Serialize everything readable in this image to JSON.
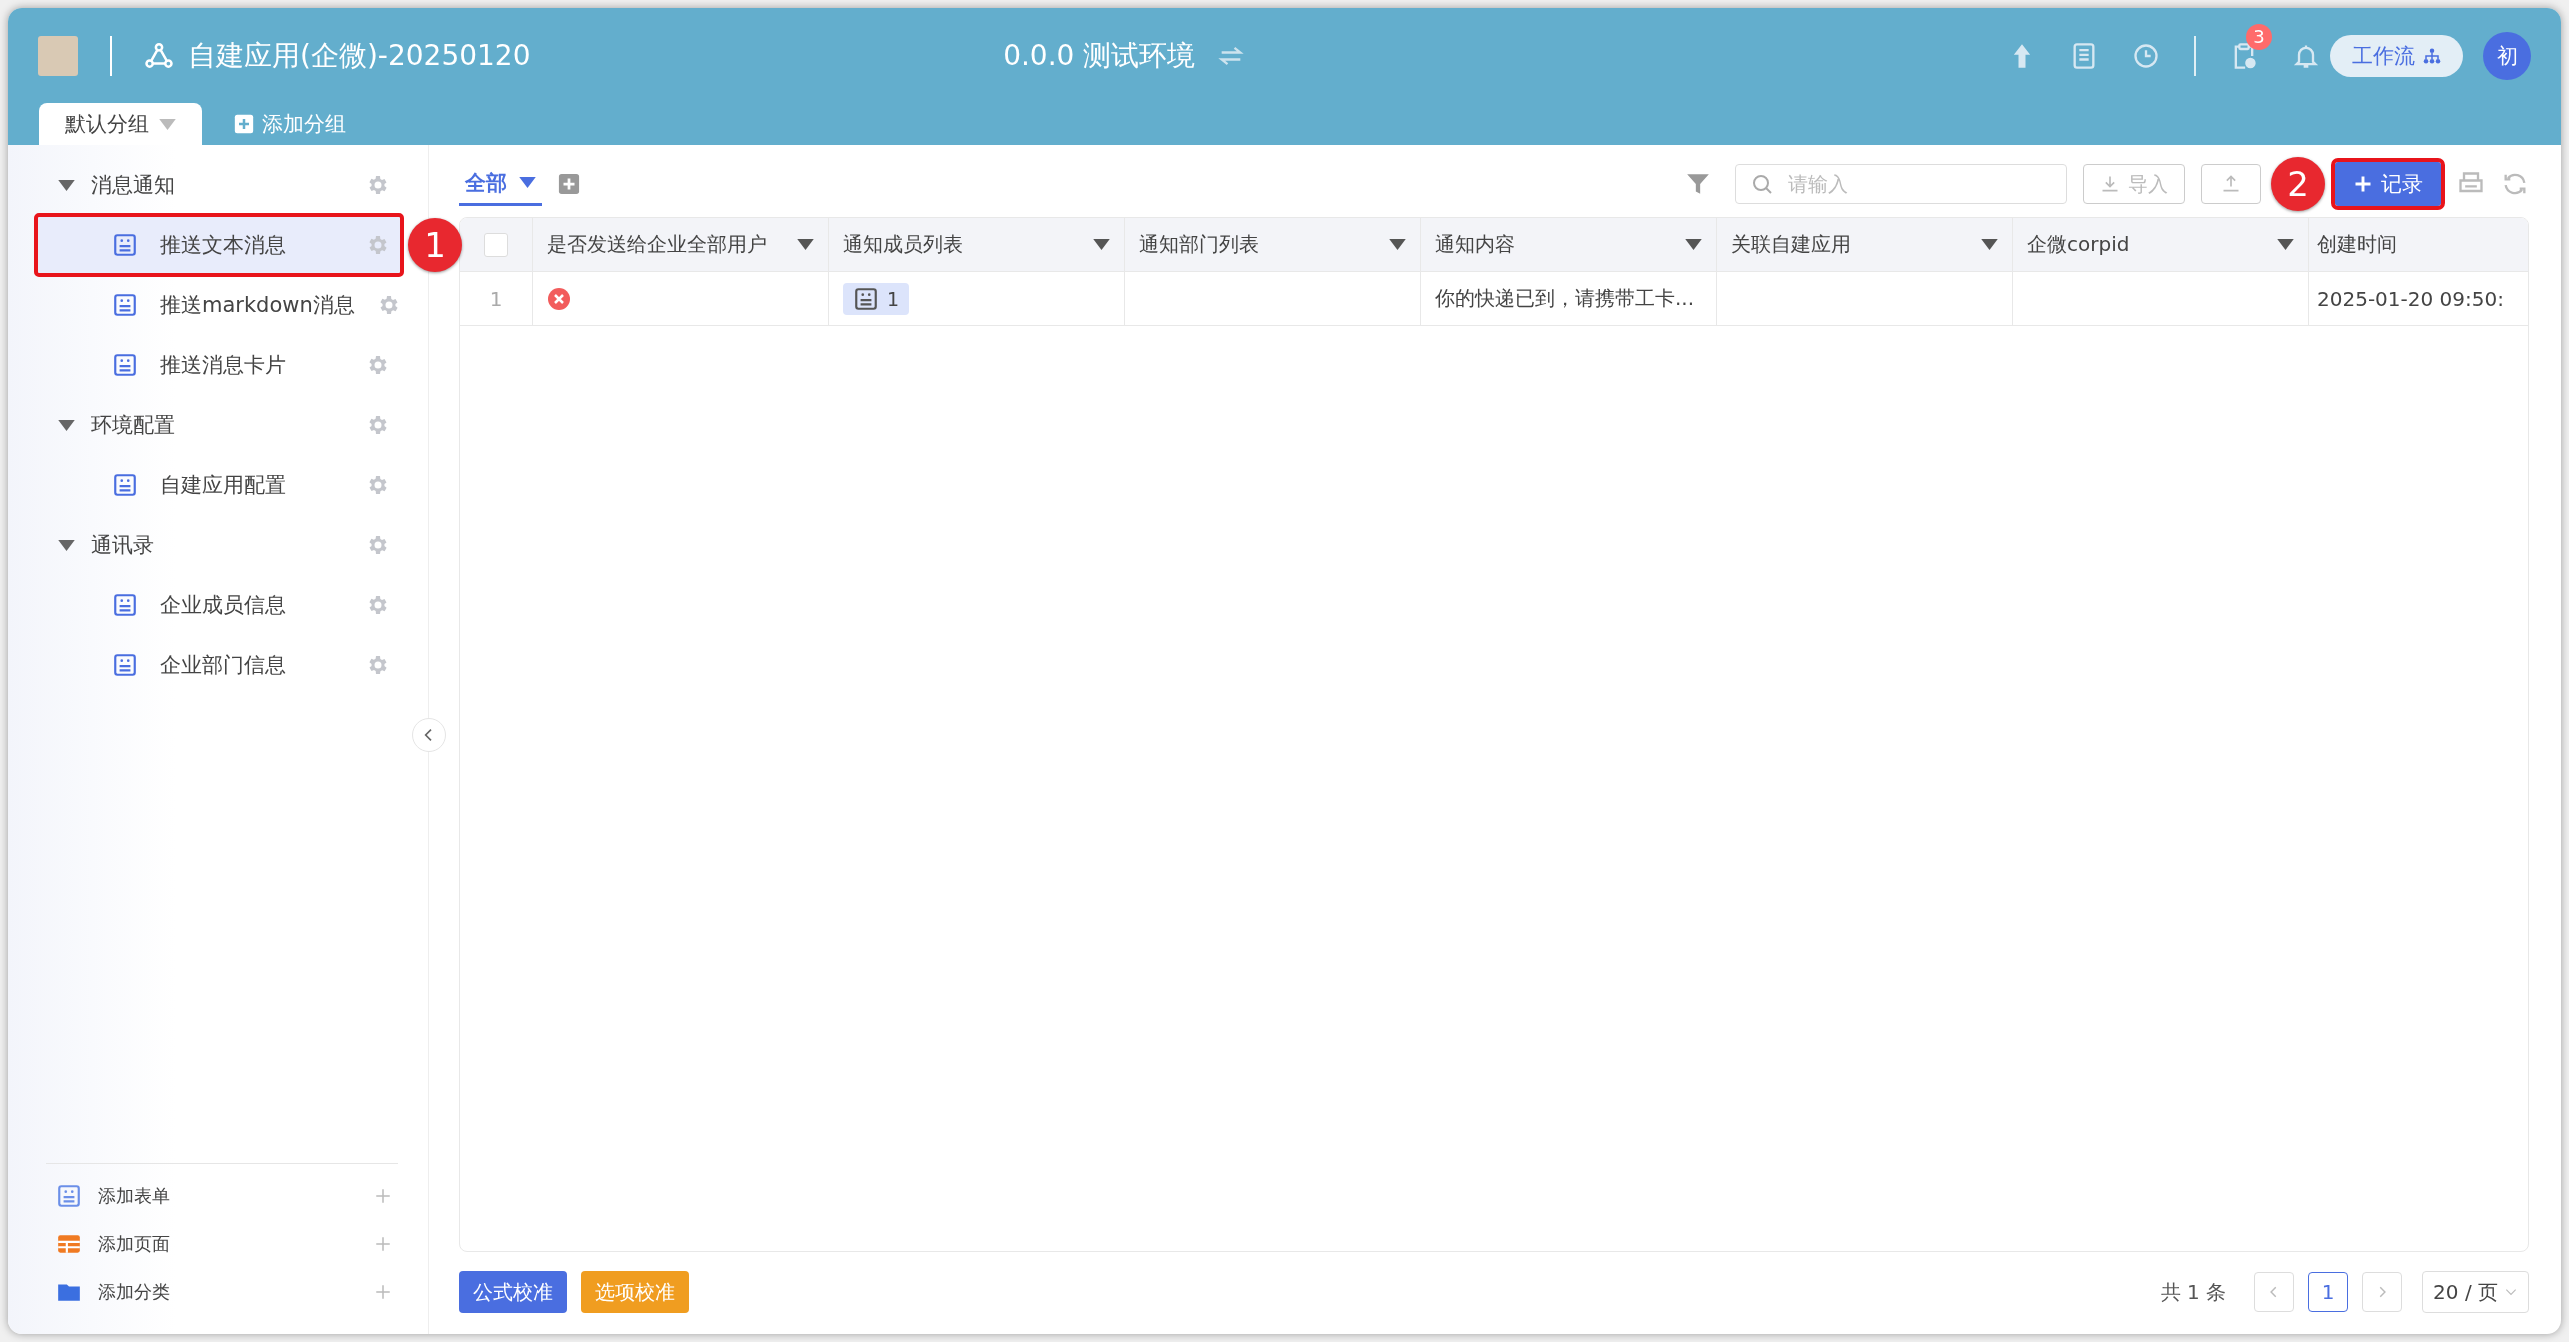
{
  "header": {
    "app_title": "自建应用(企微)-20250120",
    "environment": "0.0.0 测试环境",
    "notification_count": "3",
    "workflow_button": "工作流",
    "user_avatar": "初"
  },
  "group_tabs": [
    {
      "label": "默认分组",
      "selected": true
    }
  ],
  "add_group": "添加分组",
  "sidebar": {
    "groups": [
      {
        "label": "消息通知",
        "expanded": true,
        "children": [
          {
            "label": "推送文本消息",
            "selected": true,
            "marker": "1"
          },
          {
            "label": "推送markdown消息",
            "selected": false
          },
          {
            "label": "推送消息卡片",
            "selected": false
          }
        ]
      },
      {
        "label": "环境配置",
        "expanded": true,
        "children": [
          {
            "label": "自建应用配置",
            "selected": false
          }
        ]
      },
      {
        "label": "通讯录",
        "expanded": true,
        "children": [
          {
            "label": "企业成员信息",
            "selected": false
          },
          {
            "label": "企业部门信息",
            "selected": false
          }
        ]
      }
    ],
    "actions": [
      {
        "kind": "form",
        "label": "添加表单"
      },
      {
        "kind": "page",
        "label": "添加页面"
      },
      {
        "kind": "category",
        "label": "添加分类"
      }
    ]
  },
  "view_tabs": [
    {
      "label": "全部",
      "selected": true
    }
  ],
  "search": {
    "placeholder": "请输入"
  },
  "toolbar": {
    "import_button": "导入",
    "add_record_button": "记录",
    "add_record_marker": "2"
  },
  "table": {
    "columns": [
      {
        "label": "是否发送给企业全部用户",
        "menu": true
      },
      {
        "label": "通知成员列表",
        "menu": true
      },
      {
        "label": "通知部门列表",
        "menu": true
      },
      {
        "label": "通知内容",
        "menu": true
      },
      {
        "label": "关联自建应用",
        "menu": true
      },
      {
        "label": "企微corpid",
        "menu": true
      },
      {
        "label": "创建时间",
        "menu": false
      }
    ],
    "select_all_checked": false,
    "rows": [
      {
        "index": "1",
        "send_to_all": false,
        "members": "1",
        "content": "你的快递已到，请携带工卡...",
        "created": "2025-01-20 09:50:"
      }
    ]
  },
  "footer": {
    "buttons": [
      {
        "kind": "primary",
        "label": "公式校准"
      },
      {
        "kind": "warning",
        "label": "选项校准"
      }
    ],
    "total": "共 1 条",
    "pages": [
      {
        "label": "1",
        "selected": true
      }
    ],
    "page_size": "20 / 页"
  }
}
